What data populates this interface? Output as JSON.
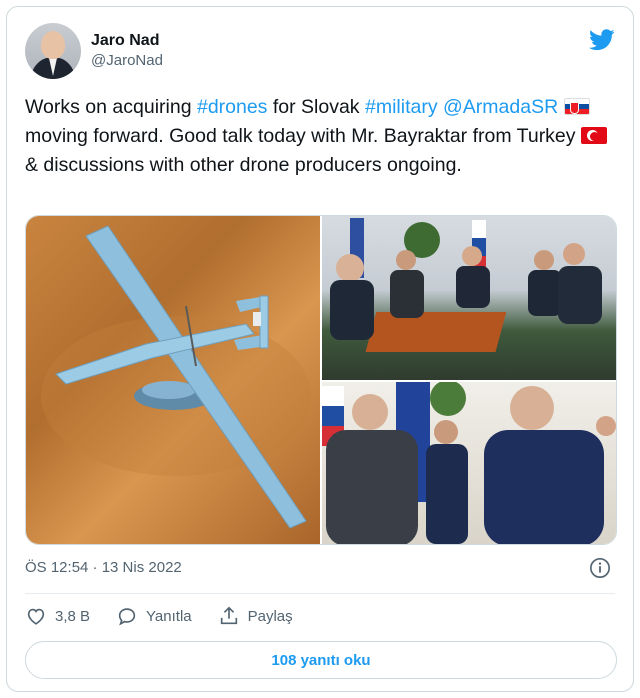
{
  "author": {
    "display_name": "Jaro Nad",
    "handle": "@JaroNad"
  },
  "tweet": {
    "line1_prefix": "Works on acquiring ",
    "hashtag_drones": "#drones",
    "line1_mid": " for Slovak ",
    "hashtag_military": "#military",
    "mention": "@ArmadaSR",
    "after_mention": " moving forward. Good talk today with Mr. Bayraktar from Turkey ",
    "after_flag": " & discussions with other drone producers ongoing.",
    "flag_slovakia": "slovakia-flag",
    "flag_turkey": "turkey-flag"
  },
  "media": {
    "photos": [
      "drone-model-photo",
      "meeting-photo",
      "handshake-photo"
    ]
  },
  "meta": {
    "timestamp": "ÖS 12:54 · 13 Nis 2022"
  },
  "actions": {
    "likes": "3,8 B",
    "reply_label": "Yanıtla",
    "share_label": "Paylaş"
  },
  "footer": {
    "replies_button": "108 yanıtı oku"
  },
  "colors": {
    "accent": "#1d9bf0",
    "text": "#0f1419",
    "muted": "#536471",
    "border": "#cfd9de"
  },
  "icons": [
    "twitter-icon",
    "info-icon",
    "heart-icon",
    "reply-icon",
    "share-icon"
  ]
}
